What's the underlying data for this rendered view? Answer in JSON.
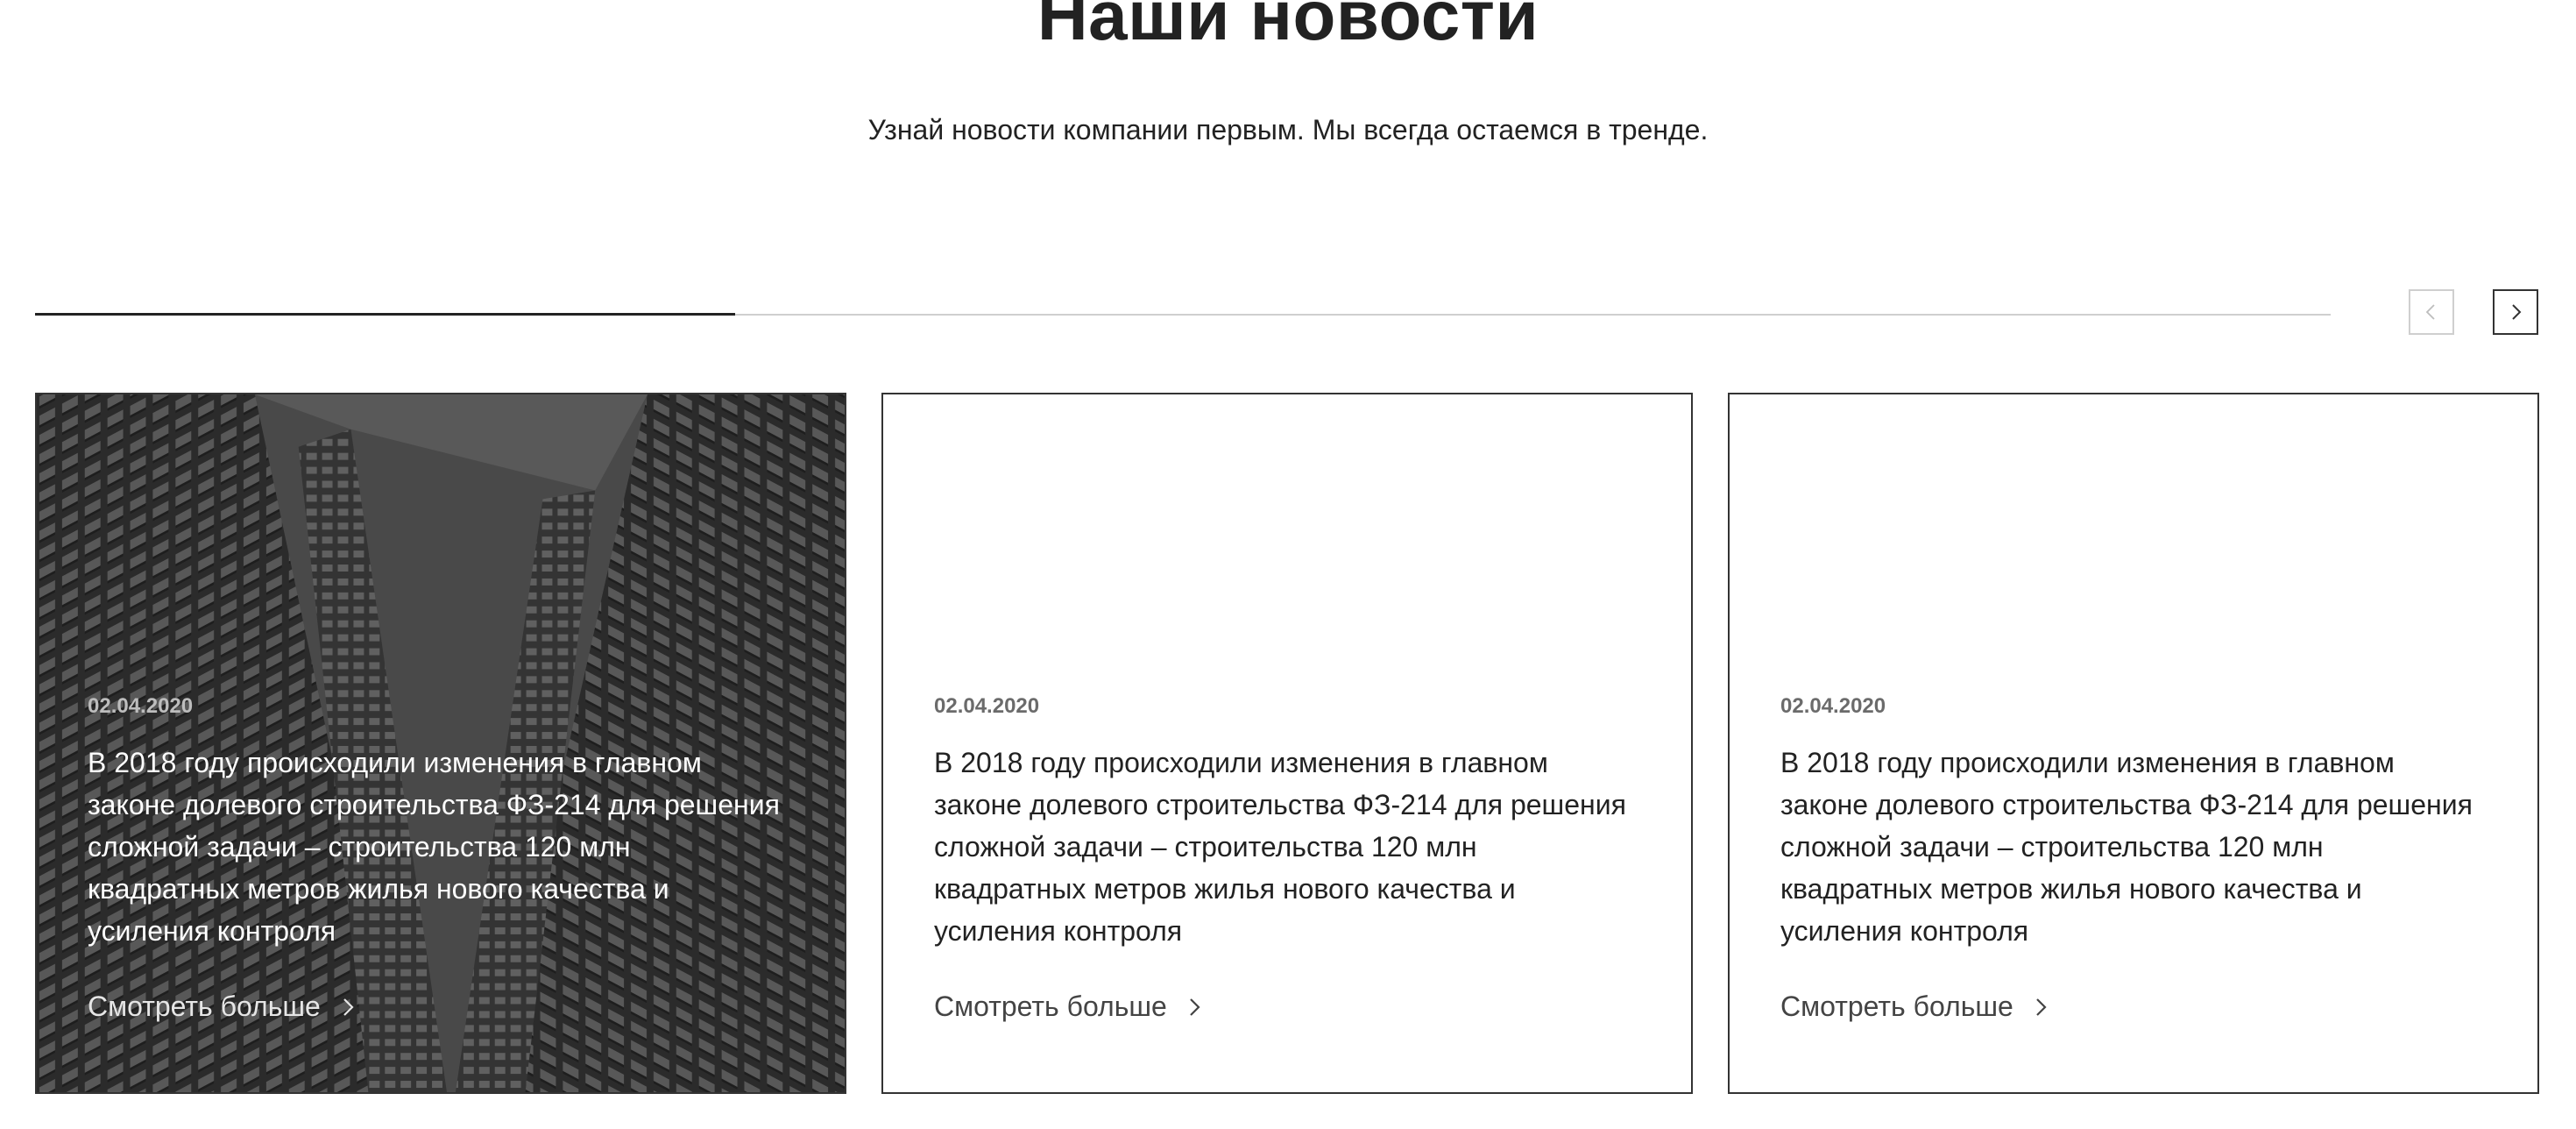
{
  "header": {
    "title": "Наши новости",
    "subtitle": "Узнай новости компании первым. Мы всегда остаемся в тренде."
  },
  "slider": {
    "progress": 0.305,
    "prev_icon": "chevron-left-icon",
    "next_icon": "chevron-right-icon"
  },
  "news": [
    {
      "date": "02.04.2020",
      "text": "В 2018 году происходили изменения в главном законе долевого строительства ФЗ-214 для решения сложной задачи – строительства 120 млн квадратных метров жилья нового качества и усиления контроля",
      "more": "Смотреть больше",
      "has_image": true
    },
    {
      "date": "02.04.2020",
      "text": "В 2018 году происходили изменения в главном законе долевого строительства ФЗ-214 для решения сложной задачи – строительства 120 млн квадратных метров жилья нового качества и усиления контроля",
      "more": "Смотреть больше",
      "has_image": false
    },
    {
      "date": "02.04.2020",
      "text": "В 2018 году происходили изменения в главном законе долевого строительства ФЗ-214 для решения сложной задачи – строительства 120 млн квадратных метров жилья нового качества и усиления контроля",
      "more": "Смотреть больше",
      "has_image": false
    }
  ],
  "colors": {
    "text": "#222222",
    "muted": "#6b6b6b",
    "border": "#333333",
    "track": "#cfcfcf",
    "photo_overlay": "#2a2a2a"
  }
}
